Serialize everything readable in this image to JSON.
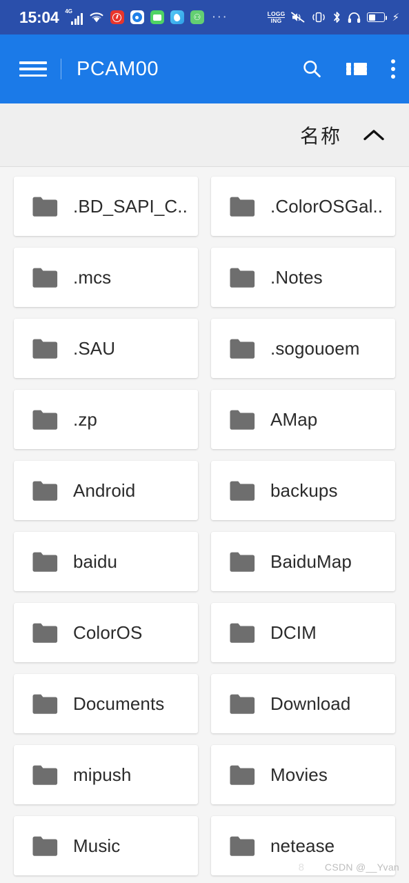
{
  "status_bar": {
    "time": "15:04",
    "network_label": "4G",
    "icons": [
      "signal-4g-icon",
      "wifi-icon",
      "netease-music-icon",
      "camera-app-icon",
      "message-app-icon",
      "weather-app-icon",
      "alipay-app-icon",
      "overflow-dots-icon"
    ],
    "overflow": "···",
    "logging_line1": "LOGG",
    "logging_line2": "ING",
    "right_icons": [
      "mute-icon",
      "vibrate-icon",
      "bluetooth-icon",
      "headphones-icon",
      "battery-icon",
      "charging-bolt-icon"
    ],
    "background_color": "#2a4fab"
  },
  "app_bar": {
    "menu_label": "menu",
    "title": "PCAM00",
    "actions": [
      {
        "name": "search",
        "icon": "search-icon"
      },
      {
        "name": "view-toggle",
        "icon": "list-view-icon"
      },
      {
        "name": "more",
        "icon": "kebab-menu-icon"
      }
    ],
    "background_color": "#1b7ae8"
  },
  "sort_bar": {
    "label": "名称",
    "direction_icon": "chevron-up-icon",
    "background_color": "#efefef"
  },
  "files": [
    {
      "name": ".BD_SAPI_C...",
      "icon": "folder-icon"
    },
    {
      "name": ".ColorOSGal...",
      "icon": "folder-icon"
    },
    {
      "name": ".mcs",
      "icon": "folder-icon"
    },
    {
      "name": ".Notes",
      "icon": "folder-icon"
    },
    {
      "name": ".SAU",
      "icon": "folder-icon"
    },
    {
      "name": ".sogouoem",
      "icon": "folder-icon"
    },
    {
      "name": ".zp",
      "icon": "folder-icon"
    },
    {
      "name": "AMap",
      "icon": "folder-icon"
    },
    {
      "name": "Android",
      "icon": "folder-icon"
    },
    {
      "name": "backups",
      "icon": "folder-icon"
    },
    {
      "name": "baidu",
      "icon": "folder-icon"
    },
    {
      "name": "BaiduMap",
      "icon": "folder-icon"
    },
    {
      "name": "ColorOS",
      "icon": "folder-icon"
    },
    {
      "name": "DCIM",
      "icon": "folder-icon"
    },
    {
      "name": "Documents",
      "icon": "folder-icon"
    },
    {
      "name": "Download",
      "icon": "folder-icon"
    },
    {
      "name": "mipush",
      "icon": "folder-icon"
    },
    {
      "name": "Movies",
      "icon": "folder-icon"
    },
    {
      "name": "Music",
      "icon": "folder-icon"
    },
    {
      "name": "netease",
      "icon": "folder-icon"
    }
  ],
  "watermark": {
    "number": "8",
    "text": "CSDN @__Yvan"
  },
  "colors": {
    "accent": "#1b7ae8",
    "status_bar": "#2a4fab",
    "folder_gray": "#6e6e6e",
    "page_background": "#f5f5f5",
    "card_background": "#ffffff"
  }
}
